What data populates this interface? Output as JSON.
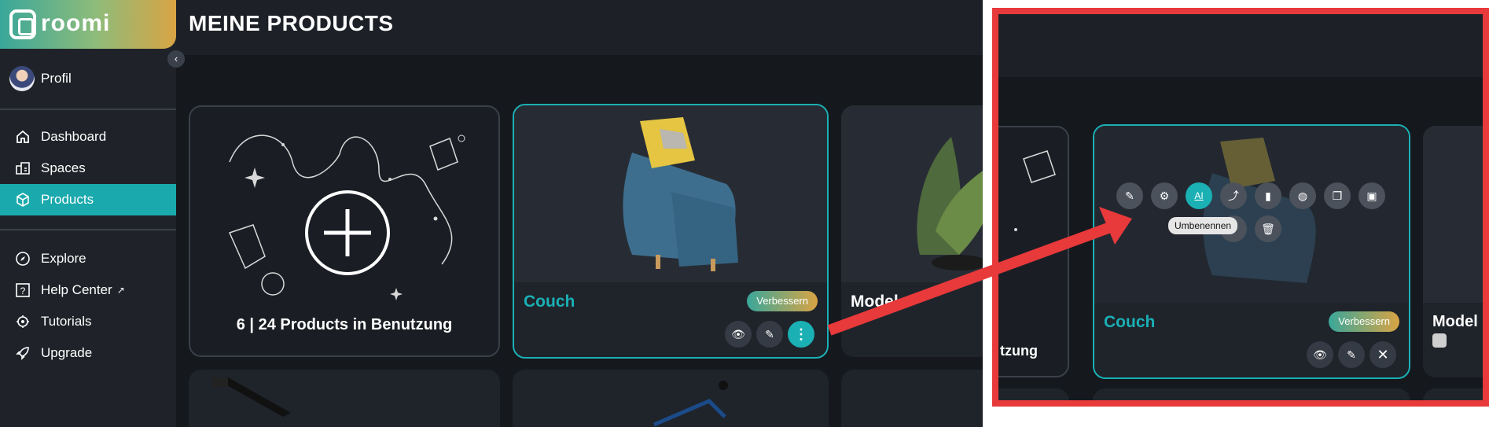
{
  "app": {
    "logo_text": "roomi",
    "title": "MEINE PRODUCTS"
  },
  "sidebar": {
    "profile_label": "Profil",
    "items": [
      {
        "label": "Dashboard",
        "icon": "home-icon"
      },
      {
        "label": "Spaces",
        "icon": "spaces-icon"
      },
      {
        "label": "Products",
        "icon": "cube-icon",
        "active": true
      },
      {
        "label": "Explore",
        "icon": "compass-icon"
      },
      {
        "label": "Help Center",
        "icon": "help-icon"
      },
      {
        "label": "Tutorials",
        "icon": "tutorials-icon"
      },
      {
        "label": "Upgrade",
        "icon": "rocket-icon"
      }
    ]
  },
  "products": {
    "add_card": {
      "count_label": "6 | 24 Products in Benutzung"
    },
    "cards": [
      {
        "name": "Couch",
        "badge": "Verbessern"
      },
      {
        "name": "Model"
      }
    ]
  },
  "inset": {
    "tooltip": "Umbenennen",
    "ai_label": "AI",
    "card_name": "Couch",
    "badge": "Verbessern",
    "partial_card_name": "Model",
    "partial_count": "tzung"
  },
  "colors": {
    "accent": "#1ab0b4",
    "highlight": "#e8393b",
    "sidebar": "#1f2329",
    "background": "#15181d"
  }
}
